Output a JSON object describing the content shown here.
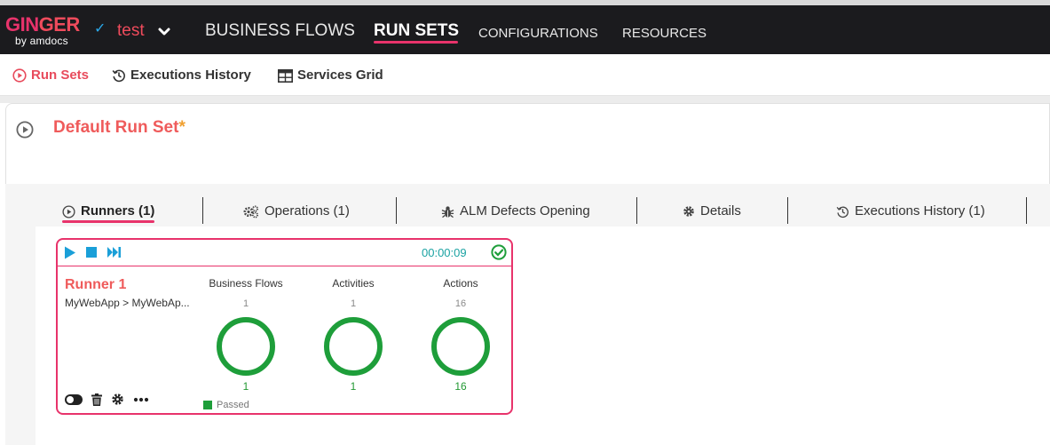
{
  "header": {
    "logo": {
      "main_part1": "GIN",
      "main_part2": "GER",
      "sub": "by amdocs"
    },
    "solution": "test",
    "nav": [
      {
        "label": "BUSINESS FLOWS",
        "active": false
      },
      {
        "label": "RUN SETS",
        "active": true
      },
      {
        "label": "CONFIGURATIONS",
        "active": false
      },
      {
        "label": "RESOURCES",
        "active": false
      }
    ]
  },
  "subnav": [
    {
      "label": "Run Sets",
      "icon": "play-circle-icon",
      "active": true
    },
    {
      "label": "Executions History",
      "icon": "history-icon",
      "active": false
    },
    {
      "label": "Services Grid",
      "icon": "grid-icon",
      "active": false
    }
  ],
  "runset": {
    "title": "Default Run Set",
    "modified_marker": "*"
  },
  "tabs": [
    {
      "label": "Runners (1)",
      "icon": "play-circle-icon",
      "active": true
    },
    {
      "label": "Operations (1)",
      "icon": "gears-icon",
      "active": false
    },
    {
      "label": "ALM Defects Opening",
      "icon": "bug-icon",
      "active": false
    },
    {
      "label": "Details",
      "icon": "gear-icon",
      "active": false
    },
    {
      "label": "Executions History (1)",
      "icon": "history-icon",
      "active": false
    }
  ],
  "runner": {
    "name": "Runner 1",
    "flow_path": "MyWebApp > MyWebAp...",
    "elapsed": "00:00:09",
    "status": "passed",
    "columns": [
      {
        "label": "Business Flows",
        "total": "1",
        "passed": "1"
      },
      {
        "label": "Activities",
        "total": "1",
        "passed": "1"
      },
      {
        "label": "Actions",
        "total": "16",
        "passed": "16"
      }
    ],
    "legend_passed": "Passed"
  },
  "colors": {
    "accent": "#e8336b",
    "title": "#ef5b5b",
    "passed": "#1e9e3a",
    "elapsed": "#1aa2a2",
    "control": "#1a9fd8"
  }
}
